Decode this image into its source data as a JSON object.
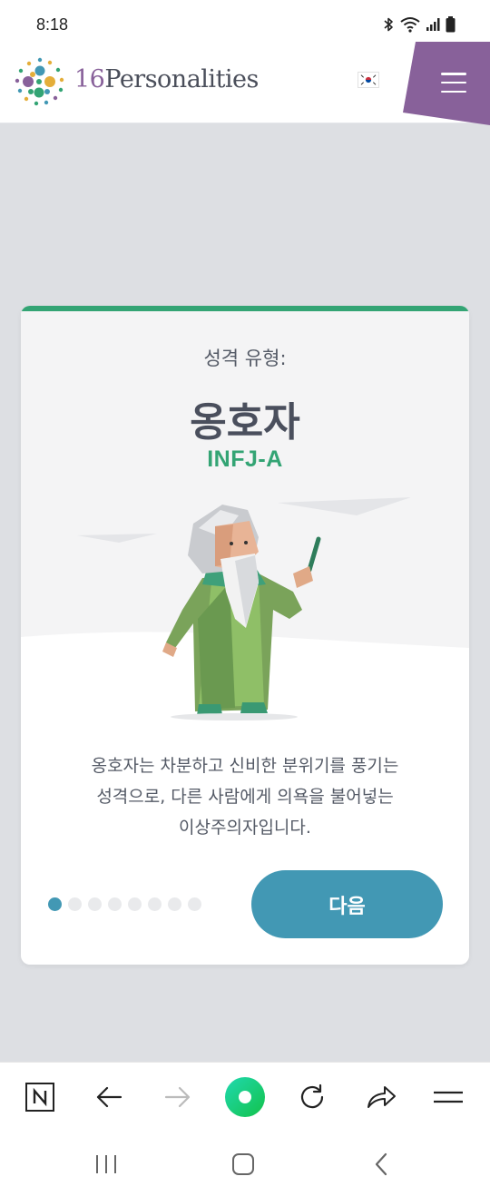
{
  "status_bar": {
    "time": "8:18",
    "icons": [
      "bluetooth-icon",
      "wifi-icon",
      "signal-icon",
      "battery-icon"
    ]
  },
  "header": {
    "logo_number": "16",
    "logo_word": "Personalities",
    "flag": "korea-flag-icon",
    "menu_icon": "hamburger-menu-icon",
    "menu_color": "#88619a"
  },
  "card": {
    "eyebrow": "성격 유형:",
    "type_name": "옹호자",
    "type_code": "INFJ-A",
    "description_lines": [
      "옹호자는 차분하고 신비한 분위기를 풍기는",
      "성격으로, 다른 사람에게 의욕을 불어넣는",
      "이상주의자입니다."
    ],
    "pagination": {
      "total": 8,
      "current": 1
    },
    "next_label": "다음",
    "colors": {
      "accent": "#33a474",
      "button": "#4298b4",
      "text": "#4a4f5d"
    }
  },
  "browser_toolbar": {
    "items": [
      "naver-n-icon",
      "back-arrow-icon",
      "forward-arrow-icon",
      "green-dot-icon",
      "reload-icon",
      "share-icon",
      "menu-icon"
    ]
  },
  "system_nav": {
    "items": [
      "recent-apps-icon",
      "home-icon",
      "back-icon"
    ]
  }
}
